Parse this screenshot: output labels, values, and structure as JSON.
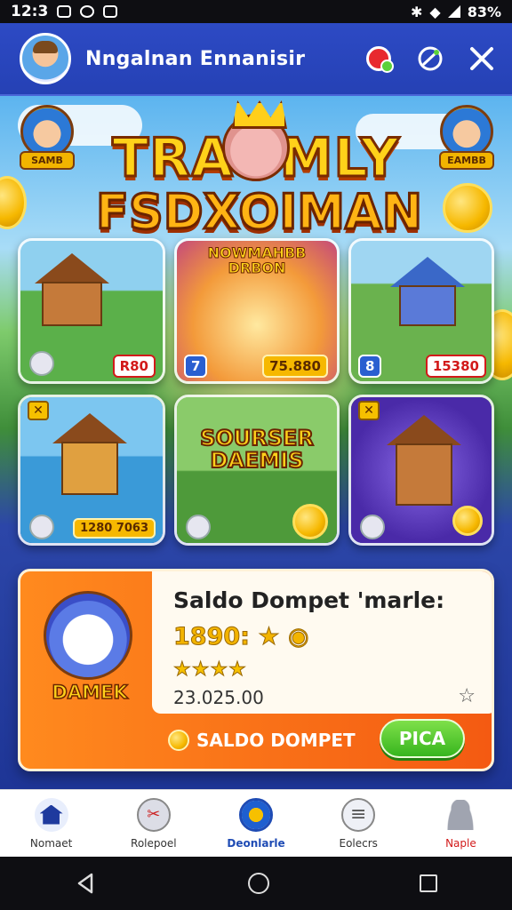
{
  "status_bar": {
    "time": "12:3",
    "battery": "83%"
  },
  "header": {
    "title": "Nngalnan Ennanisir"
  },
  "game": {
    "logo_line1": "TRAOMLY",
    "logo_line2": "FSDXOIMAN",
    "corner_left_label": "SAMB",
    "corner_right_label": "EAMBB",
    "tiles": [
      {
        "badge_right": "R80"
      },
      {
        "subtitle": "NOWMAHBB\nDRBON",
        "badge_left": "7",
        "badge_right": "75.880"
      },
      {
        "badge_left": "8",
        "badge_right": "15380"
      },
      {
        "badge_right": "1280 7063"
      },
      {
        "big_text": "SOURSER\nDAEMIS"
      },
      {}
    ]
  },
  "wallet": {
    "mascot_label": "DAMEK",
    "heading": "Saldo Dompet 'marle:",
    "amount": "1890:",
    "stars": "★★★★",
    "balance": "23.025.00",
    "saldo_label": "SALDO DOMPET",
    "play_label": "PICA"
  },
  "bottom_nav": {
    "items": [
      {
        "label": "Nomaet"
      },
      {
        "label": "Rolepoel"
      },
      {
        "label": "Deonlarle"
      },
      {
        "label": "Eolecrs"
      },
      {
        "label": "Naple"
      }
    ]
  }
}
